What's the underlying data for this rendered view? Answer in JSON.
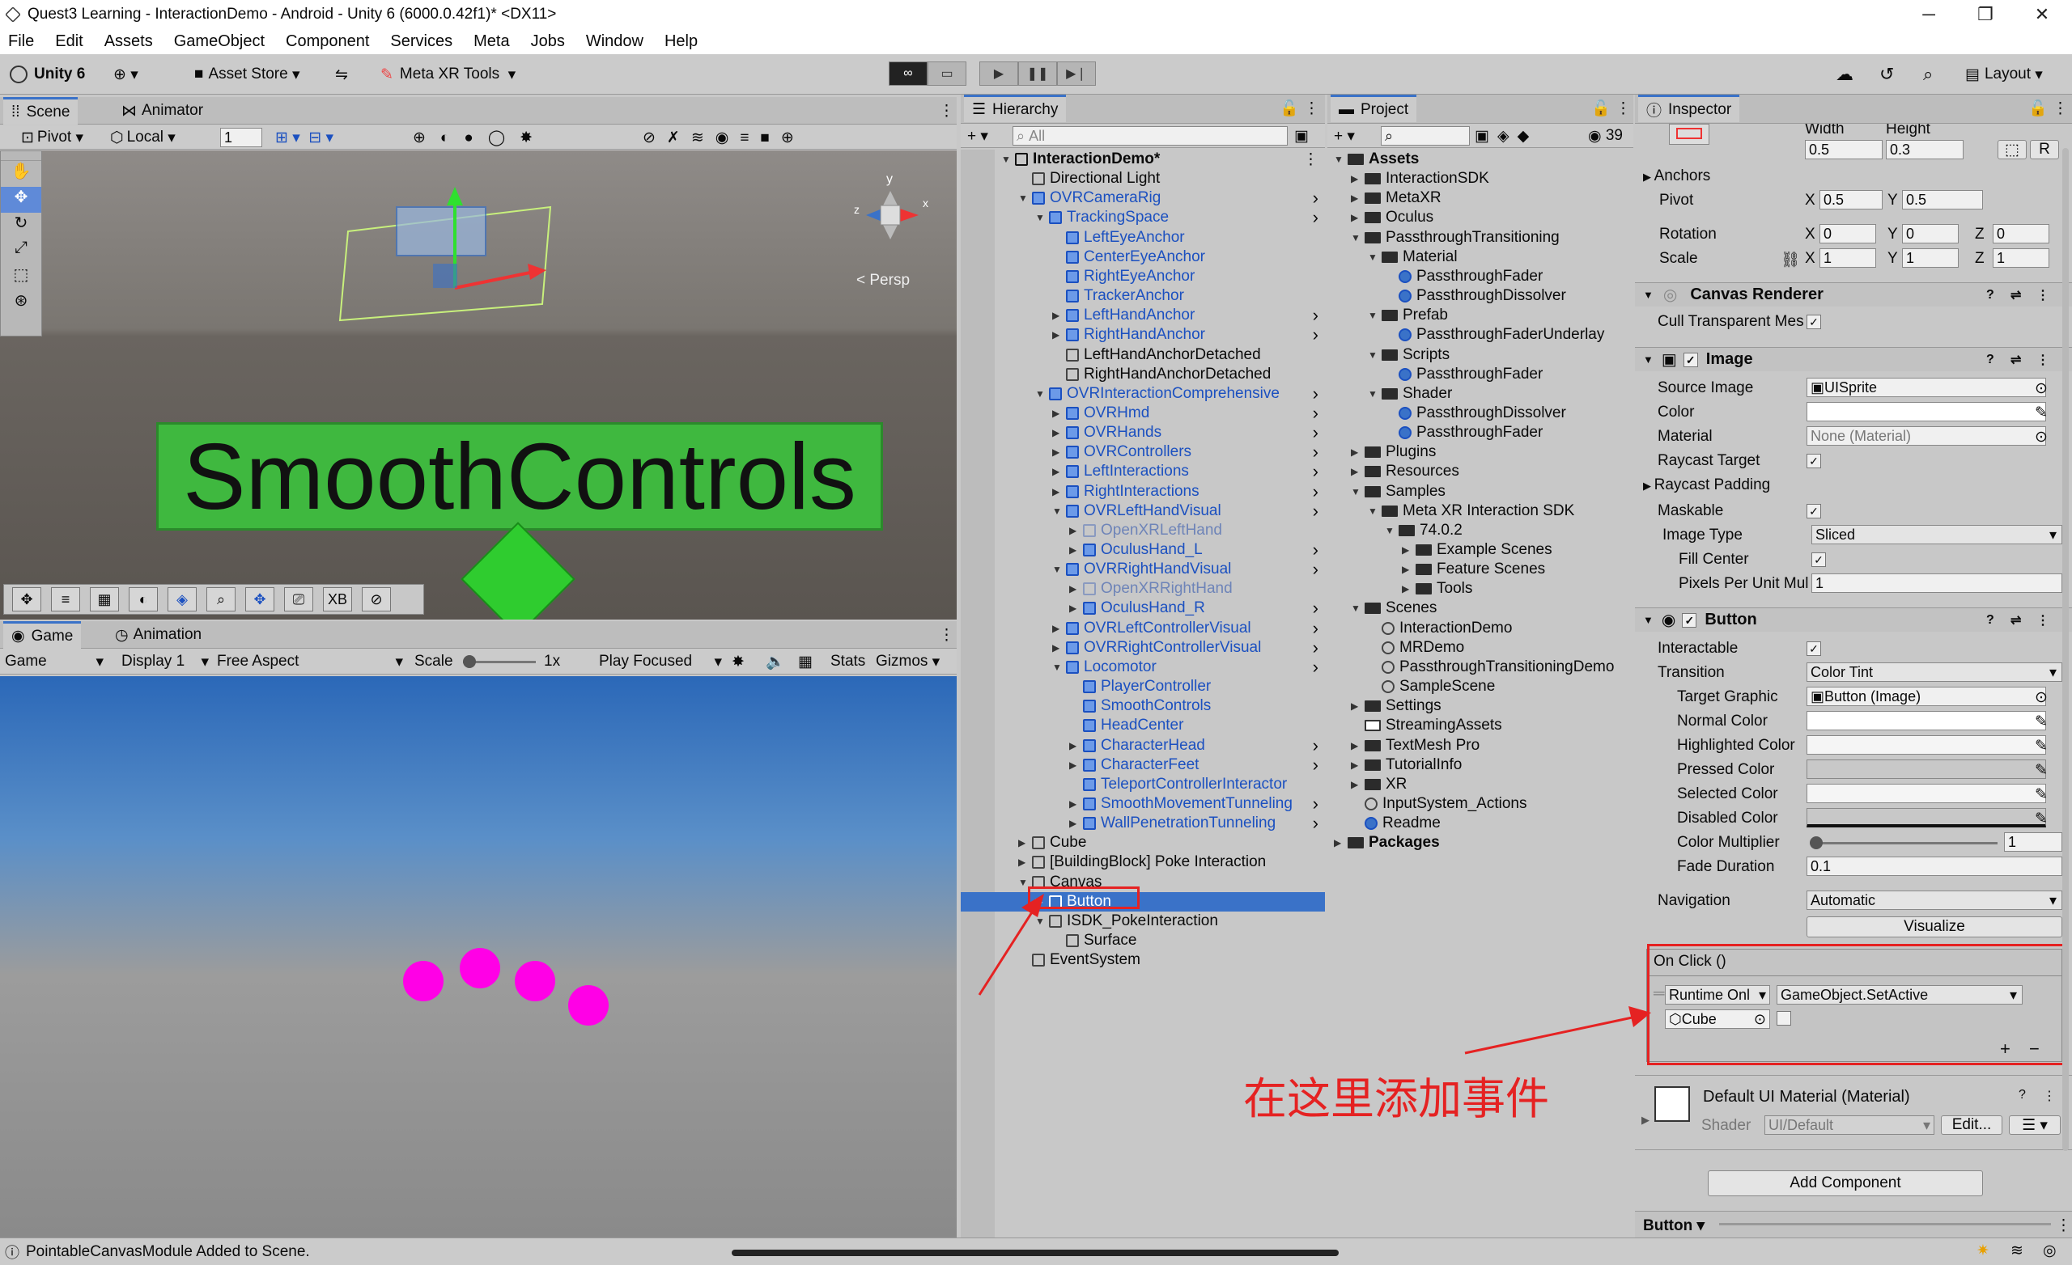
{
  "window": {
    "title": "Quest3 Learning - InteractionDemo - Android - Unity 6 (6000.0.42f1)* <DX11>"
  },
  "menu": [
    "File",
    "Edit",
    "Assets",
    "GameObject",
    "Component",
    "Services",
    "Meta",
    "Jobs",
    "Window",
    "Help"
  ],
  "toolbar": {
    "account": "Unity 6",
    "asset_store": "Asset Store",
    "meta_tools": "Meta XR Tools",
    "layout": "Layout"
  },
  "scene": {
    "tab_scene": "Scene",
    "tab_animator": "Animator",
    "pivot": "Pivot",
    "local": "Local",
    "grid_num": "1",
    "persp": "< Persp",
    "banner": "SmoothControls",
    "xb": "XB"
  },
  "game": {
    "tab_game": "Game",
    "tab_animation": "Animation",
    "game_select": "Game",
    "display": "Display 1",
    "aspect": "Free Aspect",
    "scale_label": "Scale",
    "scale_val": "1x",
    "play_focused": "Play Focused",
    "stats": "Stats",
    "gizmos": "Gizmos"
  },
  "hierarchy": {
    "title": "Hierarchy",
    "search": "All",
    "rows": [
      {
        "t": "InteractionDemo*",
        "l": 0,
        "bold": true
      },
      {
        "t": "Directional Light",
        "l": 1
      },
      {
        "t": "OVRCameraRig",
        "l": 1,
        "c": "blue"
      },
      {
        "t": "TrackingSpace",
        "l": 2,
        "c": "blue"
      },
      {
        "t": "LeftEyeAnchor",
        "l": 3,
        "c": "blue"
      },
      {
        "t": "CenterEyeAnchor",
        "l": 3,
        "c": "blue"
      },
      {
        "t": "RightEyeAnchor",
        "l": 3,
        "c": "blue"
      },
      {
        "t": "TrackerAnchor",
        "l": 3,
        "c": "blue"
      },
      {
        "t": "LeftHandAnchor",
        "l": 3,
        "c": "blue"
      },
      {
        "t": "RightHandAnchor",
        "l": 3,
        "c": "blue"
      },
      {
        "t": "LeftHandAnchorDetached",
        "l": 3
      },
      {
        "t": "RightHandAnchorDetached",
        "l": 3
      },
      {
        "t": "OVRInteractionComprehensive",
        "l": 2,
        "c": "blue"
      },
      {
        "t": "OVRHmd",
        "l": 3,
        "c": "blue"
      },
      {
        "t": "OVRHands",
        "l": 3,
        "c": "blue"
      },
      {
        "t": "OVRControllers",
        "l": 3,
        "c": "blue"
      },
      {
        "t": "LeftInteractions",
        "l": 3,
        "c": "blue"
      },
      {
        "t": "RightInteractions",
        "l": 3,
        "c": "blue"
      },
      {
        "t": "OVRLeftHandVisual",
        "l": 3,
        "c": "blue"
      },
      {
        "t": "OpenXRLeftHand",
        "l": 4,
        "c": "gray"
      },
      {
        "t": "OculusHand_L",
        "l": 4,
        "c": "blue"
      },
      {
        "t": "OVRRightHandVisual",
        "l": 3,
        "c": "blue"
      },
      {
        "t": "OpenXRRightHand",
        "l": 4,
        "c": "gray"
      },
      {
        "t": "OculusHand_R",
        "l": 4,
        "c": "blue"
      },
      {
        "t": "OVRLeftControllerVisual",
        "l": 3,
        "c": "blue"
      },
      {
        "t": "OVRRightControllerVisual",
        "l": 3,
        "c": "blue"
      },
      {
        "t": "Locomotor",
        "l": 3,
        "c": "blue"
      },
      {
        "t": "PlayerController",
        "l": 4,
        "c": "blue"
      },
      {
        "t": "SmoothControls",
        "l": 4,
        "c": "blue"
      },
      {
        "t": "HeadCenter",
        "l": 4,
        "c": "blue"
      },
      {
        "t": "CharacterHead",
        "l": 4,
        "c": "blue"
      },
      {
        "t": "CharacterFeet",
        "l": 4,
        "c": "blue"
      },
      {
        "t": "TeleportControllerInteractor",
        "l": 4,
        "c": "blue"
      },
      {
        "t": "SmoothMovementTunneling",
        "l": 4,
        "c": "blue"
      },
      {
        "t": "WallPenetrationTunneling",
        "l": 4,
        "c": "blue"
      },
      {
        "t": "Cube",
        "l": 1
      },
      {
        "t": "[BuildingBlock] Poke Interaction",
        "l": 1
      },
      {
        "t": "Canvas",
        "l": 1
      },
      {
        "t": "Button",
        "l": 2,
        "sel": true
      },
      {
        "t": "ISDK_PokeInteraction",
        "l": 2
      },
      {
        "t": "Surface",
        "l": 3
      },
      {
        "t": "EventSystem",
        "l": 1
      }
    ]
  },
  "project": {
    "title": "Project",
    "count": "39",
    "rows": [
      {
        "t": "Assets",
        "l": 0,
        "bold": true,
        "f": true
      },
      {
        "t": "InteractionSDK",
        "l": 1,
        "f": true
      },
      {
        "t": "MetaXR",
        "l": 1,
        "f": true
      },
      {
        "t": "Oculus",
        "l": 1,
        "f": true
      },
      {
        "t": "PassthroughTransitioning",
        "l": 1,
        "f": true
      },
      {
        "t": "Material",
        "l": 2,
        "f": true
      },
      {
        "t": "PassthroughFader",
        "l": 3
      },
      {
        "t": "PassthroughDissolver",
        "l": 3
      },
      {
        "t": "Prefab",
        "l": 2,
        "f": true
      },
      {
        "t": "PassthroughFaderUnderlay",
        "l": 3
      },
      {
        "t": "Scripts",
        "l": 2,
        "f": true
      },
      {
        "t": "PassthroughFader",
        "l": 3
      },
      {
        "t": "Shader",
        "l": 2,
        "f": true
      },
      {
        "t": "PassthroughDissolver",
        "l": 3
      },
      {
        "t": "PassthroughFader",
        "l": 3
      },
      {
        "t": "Plugins",
        "l": 1,
        "f": true
      },
      {
        "t": "Resources",
        "l": 1,
        "f": true
      },
      {
        "t": "Samples",
        "l": 1,
        "f": true
      },
      {
        "t": "Meta XR Interaction SDK",
        "l": 2,
        "f": true
      },
      {
        "t": "74.0.2",
        "l": 3,
        "f": true
      },
      {
        "t": "Example Scenes",
        "l": 4,
        "f": true
      },
      {
        "t": "Feature Scenes",
        "l": 4,
        "f": true
      },
      {
        "t": "Tools",
        "l": 4,
        "f": true
      },
      {
        "t": "Scenes",
        "l": 1,
        "f": true
      },
      {
        "t": "InteractionDemo",
        "l": 2
      },
      {
        "t": "MRDemo",
        "l": 2
      },
      {
        "t": "PassthroughTransitioningDemo",
        "l": 2
      },
      {
        "t": "SampleScene",
        "l": 2
      },
      {
        "t": "Settings",
        "l": 1,
        "f": true
      },
      {
        "t": "StreamingAssets",
        "l": 1,
        "f": true
      },
      {
        "t": "TextMesh Pro",
        "l": 1,
        "f": true
      },
      {
        "t": "TutorialInfo",
        "l": 1,
        "f": true
      },
      {
        "t": "XR",
        "l": 1,
        "f": true
      },
      {
        "t": "InputSystem_Actions",
        "l": 1
      },
      {
        "t": "Readme",
        "l": 1
      },
      {
        "t": "Packages",
        "l": 0,
        "bold": true,
        "f": true
      }
    ]
  },
  "inspector": {
    "title": "Inspector",
    "rect": {
      "width_lbl": "Width",
      "height_lbl": "Height",
      "width": "0.5",
      "height": "0.3",
      "anchors": "Anchors",
      "pivot": "Pivot",
      "pivot_x": "0.5",
      "pivot_y": "0.5",
      "rotation": "Rotation",
      "rot_x": "0",
      "rot_y": "0",
      "rot_z": "0",
      "scale": "Scale",
      "sc_x": "1",
      "sc_y": "1",
      "sc_z": "1",
      "x": "X",
      "y": "Y",
      "z": "Z",
      "r": "R"
    },
    "canvas_renderer": {
      "title": "Canvas Renderer",
      "cull": "Cull Transparent Mes"
    },
    "image": {
      "title": "Image",
      "source_lbl": "Source Image",
      "source": "UISprite",
      "color": "Color",
      "material_lbl": "Material",
      "material": "None (Material)",
      "raycast": "Raycast Target",
      "padding": "Raycast Padding",
      "maskable": "Maskable",
      "type_lbl": "Image Type",
      "type": "Sliced",
      "fill": "Fill Center",
      "ppu_lbl": "Pixels Per Unit Mul",
      "ppu": "1"
    },
    "button": {
      "title": "Button",
      "interactable": "Interactable",
      "transition_lbl": "Transition",
      "transition": "Color Tint",
      "target_lbl": "Target Graphic",
      "target": "Button (Image)",
      "normal": "Normal Color",
      "highlighted": "Highlighted Color",
      "pressed": "Pressed Color",
      "selected": "Selected Color",
      "disabled": "Disabled Color",
      "mult_lbl": "Color Multiplier",
      "mult": "1",
      "fade_lbl": "Fade Duration",
      "fade": "0.1",
      "nav_lbl": "Navigation",
      "nav": "Automatic",
      "visualize": "Visualize"
    },
    "onclick": {
      "title": "On Click ()",
      "runtime": "Runtime Onl",
      "function": "GameObject.SetActive",
      "object": "Cube",
      "plus": "+",
      "minus": "−"
    },
    "material": {
      "title": "Default UI Material (Material)",
      "shader_lbl": "Shader",
      "shader": "UI/Default",
      "edit": "Edit..."
    },
    "add_component": "Add Component",
    "footer": "Button"
  },
  "annotation": {
    "text": "在这里添加事件"
  },
  "status": {
    "message": "PointableCanvasModule Added to Scene."
  },
  "colors": {
    "accent": "#3a72c8",
    "annot": "#e52222",
    "banner": "#3fb83f",
    "dots": "#ff00e6"
  }
}
